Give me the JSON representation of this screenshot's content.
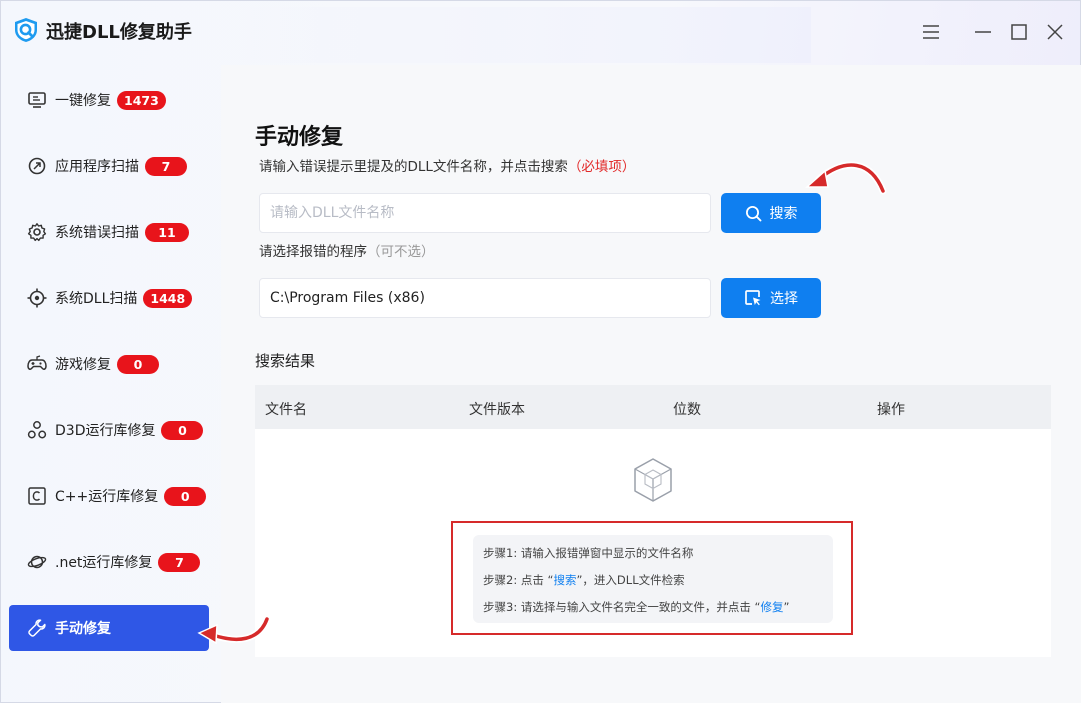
{
  "app": {
    "title": "迅捷DLL修复助手"
  },
  "window_controls": {
    "menu": "menu-icon",
    "minimize": "minimize-icon",
    "maximize": "maximize-icon",
    "close": "close-icon"
  },
  "sidebar": {
    "items": [
      {
        "label": "一键修复",
        "badge": "1473",
        "icon": "monitor-icon"
      },
      {
        "label": "应用程序扫描",
        "badge": "7",
        "icon": "app-scan-icon"
      },
      {
        "label": "系统错误扫描",
        "badge": "11",
        "icon": "gear-icon"
      },
      {
        "label": "系统DLL扫描",
        "badge": "1448",
        "icon": "target-icon"
      },
      {
        "label": "游戏修复",
        "badge": "0",
        "icon": "gamepad-icon"
      },
      {
        "label": "D3D运行库修复",
        "badge": "0",
        "icon": "d3d-icon"
      },
      {
        "label": "C++运行库修复",
        "badge": "0",
        "icon": "cpp-icon"
      },
      {
        "label": ".net运行库修复",
        "badge": "7",
        "icon": "planet-icon"
      },
      {
        "label": "手动修复",
        "badge": "",
        "icon": "wrench-icon",
        "active": true
      }
    ]
  },
  "main": {
    "title": "手动修复",
    "hint": "请输入错误提示里提及的DLL文件名称，并点击搜索",
    "hint_required": "（必填项）",
    "search": {
      "placeholder": "请输入DLL文件名称",
      "value": "",
      "button_label": "搜索"
    },
    "program": {
      "hint": "请选择报错的程序",
      "hint_optional": "（可不选）",
      "value": "C:\\Program Files (x86)",
      "button_label": "选择"
    },
    "results": {
      "title": "搜索结果",
      "columns": [
        "文件名",
        "文件版本",
        "位数",
        "操作"
      ],
      "steps": [
        {
          "prefix": "步骤1: 请输入报错弹窗中显示的文件名称",
          "link": "",
          "suffix": ""
        },
        {
          "prefix": "步骤2: 点击 “",
          "link": "搜索",
          "suffix": "”，进入DLL文件检索"
        },
        {
          "prefix": "步骤3: 请选择与输入文件名完全一致的文件，并点击 “",
          "link": "修复",
          "suffix": "”"
        }
      ]
    }
  },
  "colors": {
    "accent": "#0f7ff0",
    "active_nav": "#2f57e6",
    "badge": "#e8141b",
    "annotation": "#d62a2a"
  }
}
